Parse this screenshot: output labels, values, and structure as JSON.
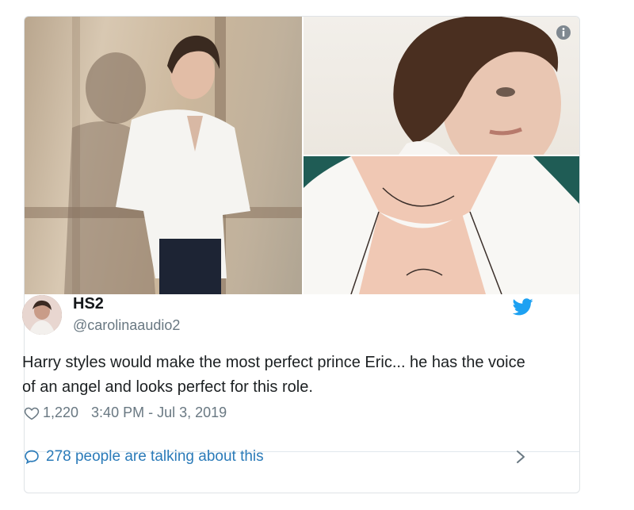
{
  "tweet": {
    "display_name": "HS2",
    "handle": "@carolinaaudio2",
    "text": "Harry styles would make the most perfect prince Eric... he has the voice of an angel and looks perfect for this role.",
    "likes": "1,220",
    "timestamp": "3:40 PM - Jul 3, 2019",
    "talking": "278 people are talking about this"
  },
  "icons": {
    "info": "info-icon",
    "twitter": "twitter-bird-icon",
    "like": "heart-icon",
    "reply": "speech-bubble-icon",
    "more": "chevron-right-icon"
  },
  "colors": {
    "twitter_blue": "#1da1f2",
    "link_blue": "#2b7bb9",
    "text": "#1c2022",
    "muted": "#697882"
  }
}
